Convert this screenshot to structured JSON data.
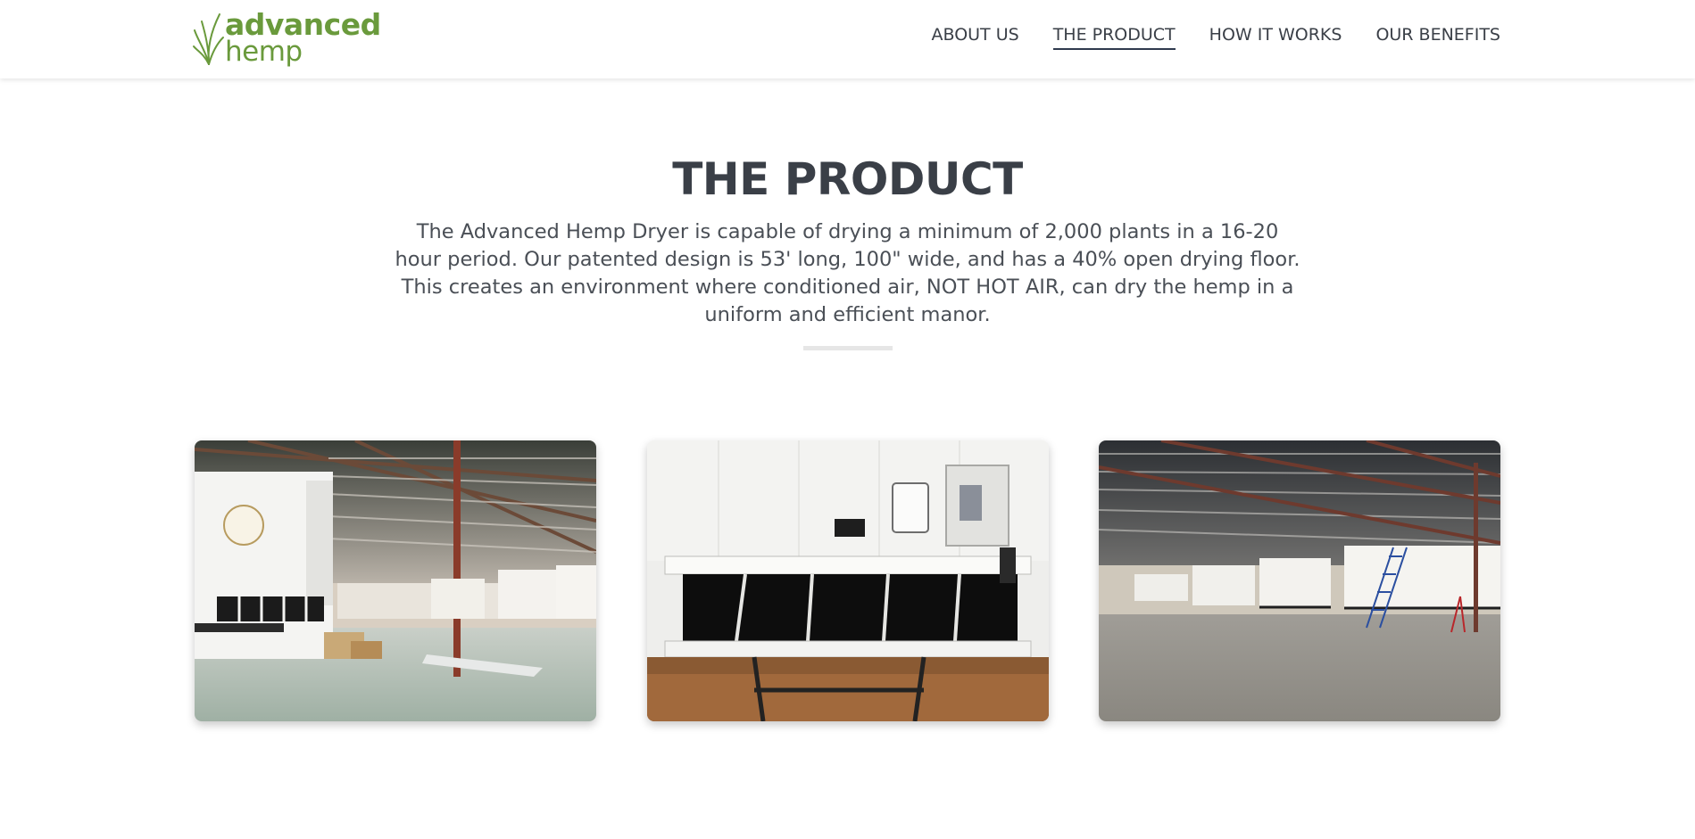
{
  "brand": {
    "name_line1": "advanced",
    "name_line2": "hemp",
    "color": "#6a9a3c"
  },
  "nav": {
    "items": [
      {
        "label": "ABOUT US",
        "active": false
      },
      {
        "label": "THE PRODUCT",
        "active": true
      },
      {
        "label": "HOW IT WORKS",
        "active": false
      },
      {
        "label": "OUR BENEFITS",
        "active": false
      }
    ]
  },
  "main": {
    "title": "THE PRODUCT",
    "description": "The Advanced Hemp Dryer is capable of drying a minimum of 2,000 plants in a 16-20 hour period. Our patented design is 53' long, 100\" wide, and has a 40% open drying floor. This creates an environment where conditioned air, NOT HOT AIR, can dry the hemp in a uniform and efficient manor."
  },
  "gallery": {
    "images": [
      {
        "name": "warehouse-trailer-with-dryer-photo"
      },
      {
        "name": "dryer-trailer-rear-closeup-photo"
      },
      {
        "name": "warehouse-row-of-trailers-photo"
      }
    ]
  },
  "colors": {
    "text": "#3a3f47",
    "accent": "#6a9a3c",
    "nav_underline": "#2f3a4d"
  }
}
